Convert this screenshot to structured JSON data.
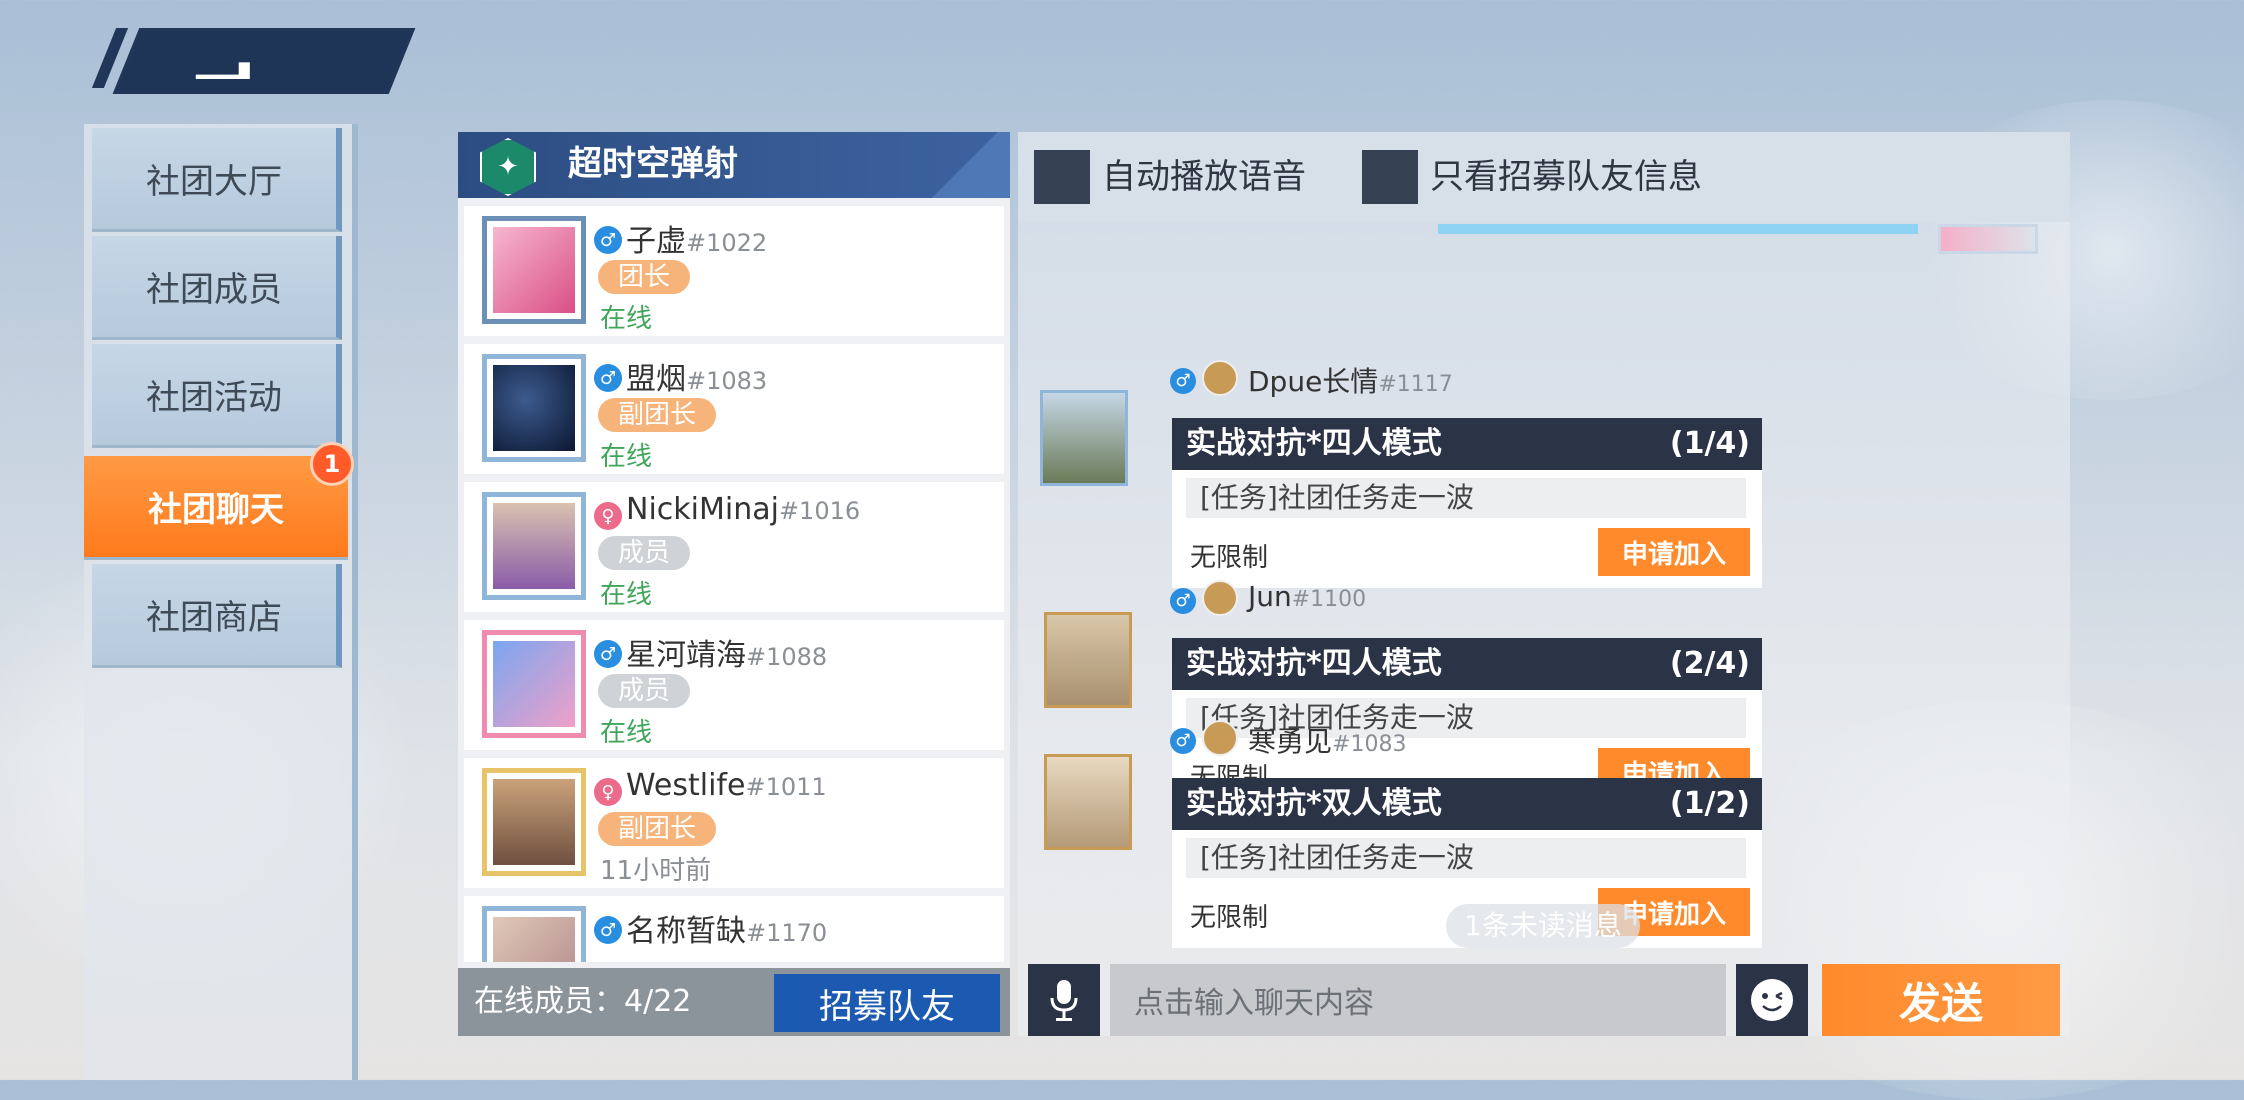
{
  "left_menu": {
    "items": [
      {
        "label": "社团大厅"
      },
      {
        "label": "社团成员"
      },
      {
        "label": "社团活动"
      },
      {
        "label": "社团聊天",
        "badge": "1"
      },
      {
        "label": "社团商店"
      }
    ]
  },
  "club": {
    "name": "超时空弹射"
  },
  "members": [
    {
      "name": "子虚",
      "id": "#1022",
      "sex": "male",
      "role": "团长",
      "status": "在线"
    },
    {
      "name": "盟烟",
      "id": "#1083",
      "sex": "male",
      "role": "副团长",
      "status": "在线"
    },
    {
      "name": "NickiMinaj",
      "id": "#1016",
      "sex": "female",
      "role": "成员",
      "status": "在线"
    },
    {
      "name": "星河靖海",
      "id": "#1088",
      "sex": "male",
      "role": "成员",
      "status": "在线"
    },
    {
      "name": "Westlife",
      "id": "#1011",
      "sex": "female",
      "role": "副团长",
      "status": "11小时前"
    },
    {
      "name": "名称暂缺",
      "id": "#1170",
      "sex": "male",
      "role": "",
      "status": ""
    }
  ],
  "member_footer": {
    "online_label": "在线成员：4/22",
    "recruit_button": "招募队友"
  },
  "chat_toolbar": {
    "auto_voice": "自动播放语音",
    "recruit_only": "只看招募队友信息"
  },
  "messages": [
    {
      "sender": "Dpue长情",
      "id": "#1117",
      "card": {
        "title": "实战对抗*四人模式",
        "count": "(1/4)",
        "task": "[任务]社团任务走一波",
        "limit": "无限制",
        "join": "申请加入"
      }
    },
    {
      "sender": "Jun",
      "id": "#1100",
      "card": {
        "title": "实战对抗*四人模式",
        "count": "(2/4)",
        "task": "[任务]社团任务走一波",
        "limit": "无限制",
        "join": "申请加入"
      }
    },
    {
      "sender": "寒勇见",
      "id": "#1083",
      "card": {
        "title": "实战对抗*双人模式",
        "count": "(1/2)",
        "task": "[任务]社团任务走一波",
        "limit": "无限制",
        "join": "申请加入"
      }
    }
  ],
  "unread": "1条未读消息",
  "chat_footer": {
    "input_placeholder": "点击输入聊天内容",
    "send_button": "发送"
  },
  "colors": {
    "accent": "#ff8a2c",
    "panel_dark": "#2b3446",
    "header_blue": "#2c4d82",
    "online_green": "#3fa65a"
  }
}
